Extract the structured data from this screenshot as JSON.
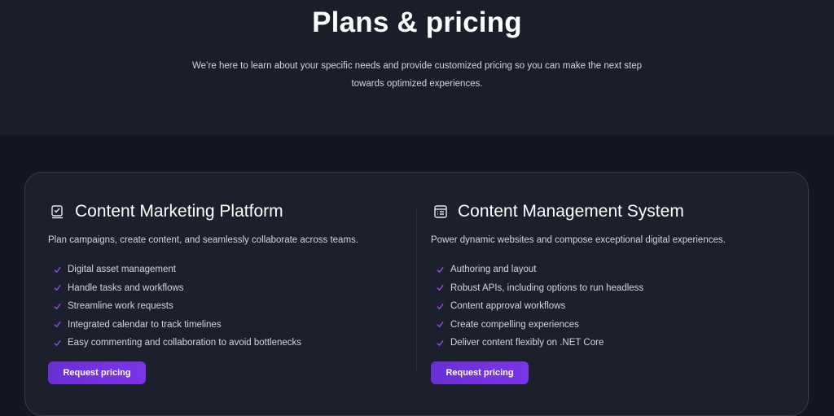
{
  "hero": {
    "title": "Plans & pricing",
    "subtitle": "We’re here to learn about your specific needs and provide customized pricing so you can make the next step towards optimized experiences."
  },
  "colors": {
    "accent": "#7b35e8",
    "check": "#8f4ae8",
    "background": "#131722",
    "card": "#1c202c"
  },
  "plans": [
    {
      "icon": "checklist-icon",
      "title": "Content Marketing Platform",
      "description": "Plan campaigns, create content, and seamlessly collaborate across teams.",
      "features": [
        "Digital asset management",
        "Handle tasks and workflows",
        "Streamline work requests",
        "Integrated calendar to track timelines",
        "Easy commenting and collaboration to avoid bottlenecks"
      ],
      "button_label": "Request pricing"
    },
    {
      "icon": "layout-document-icon",
      "title": "Content Management System",
      "description": "Power dynamic websites and compose exceptional digital experiences.",
      "features": [
        "Authoring and layout",
        "Robust APIs, including options to run headless",
        "Content approval workflows",
        "Create compelling experiences",
        "Deliver content flexibly on .NET Core"
      ],
      "button_label": "Request pricing"
    }
  ]
}
